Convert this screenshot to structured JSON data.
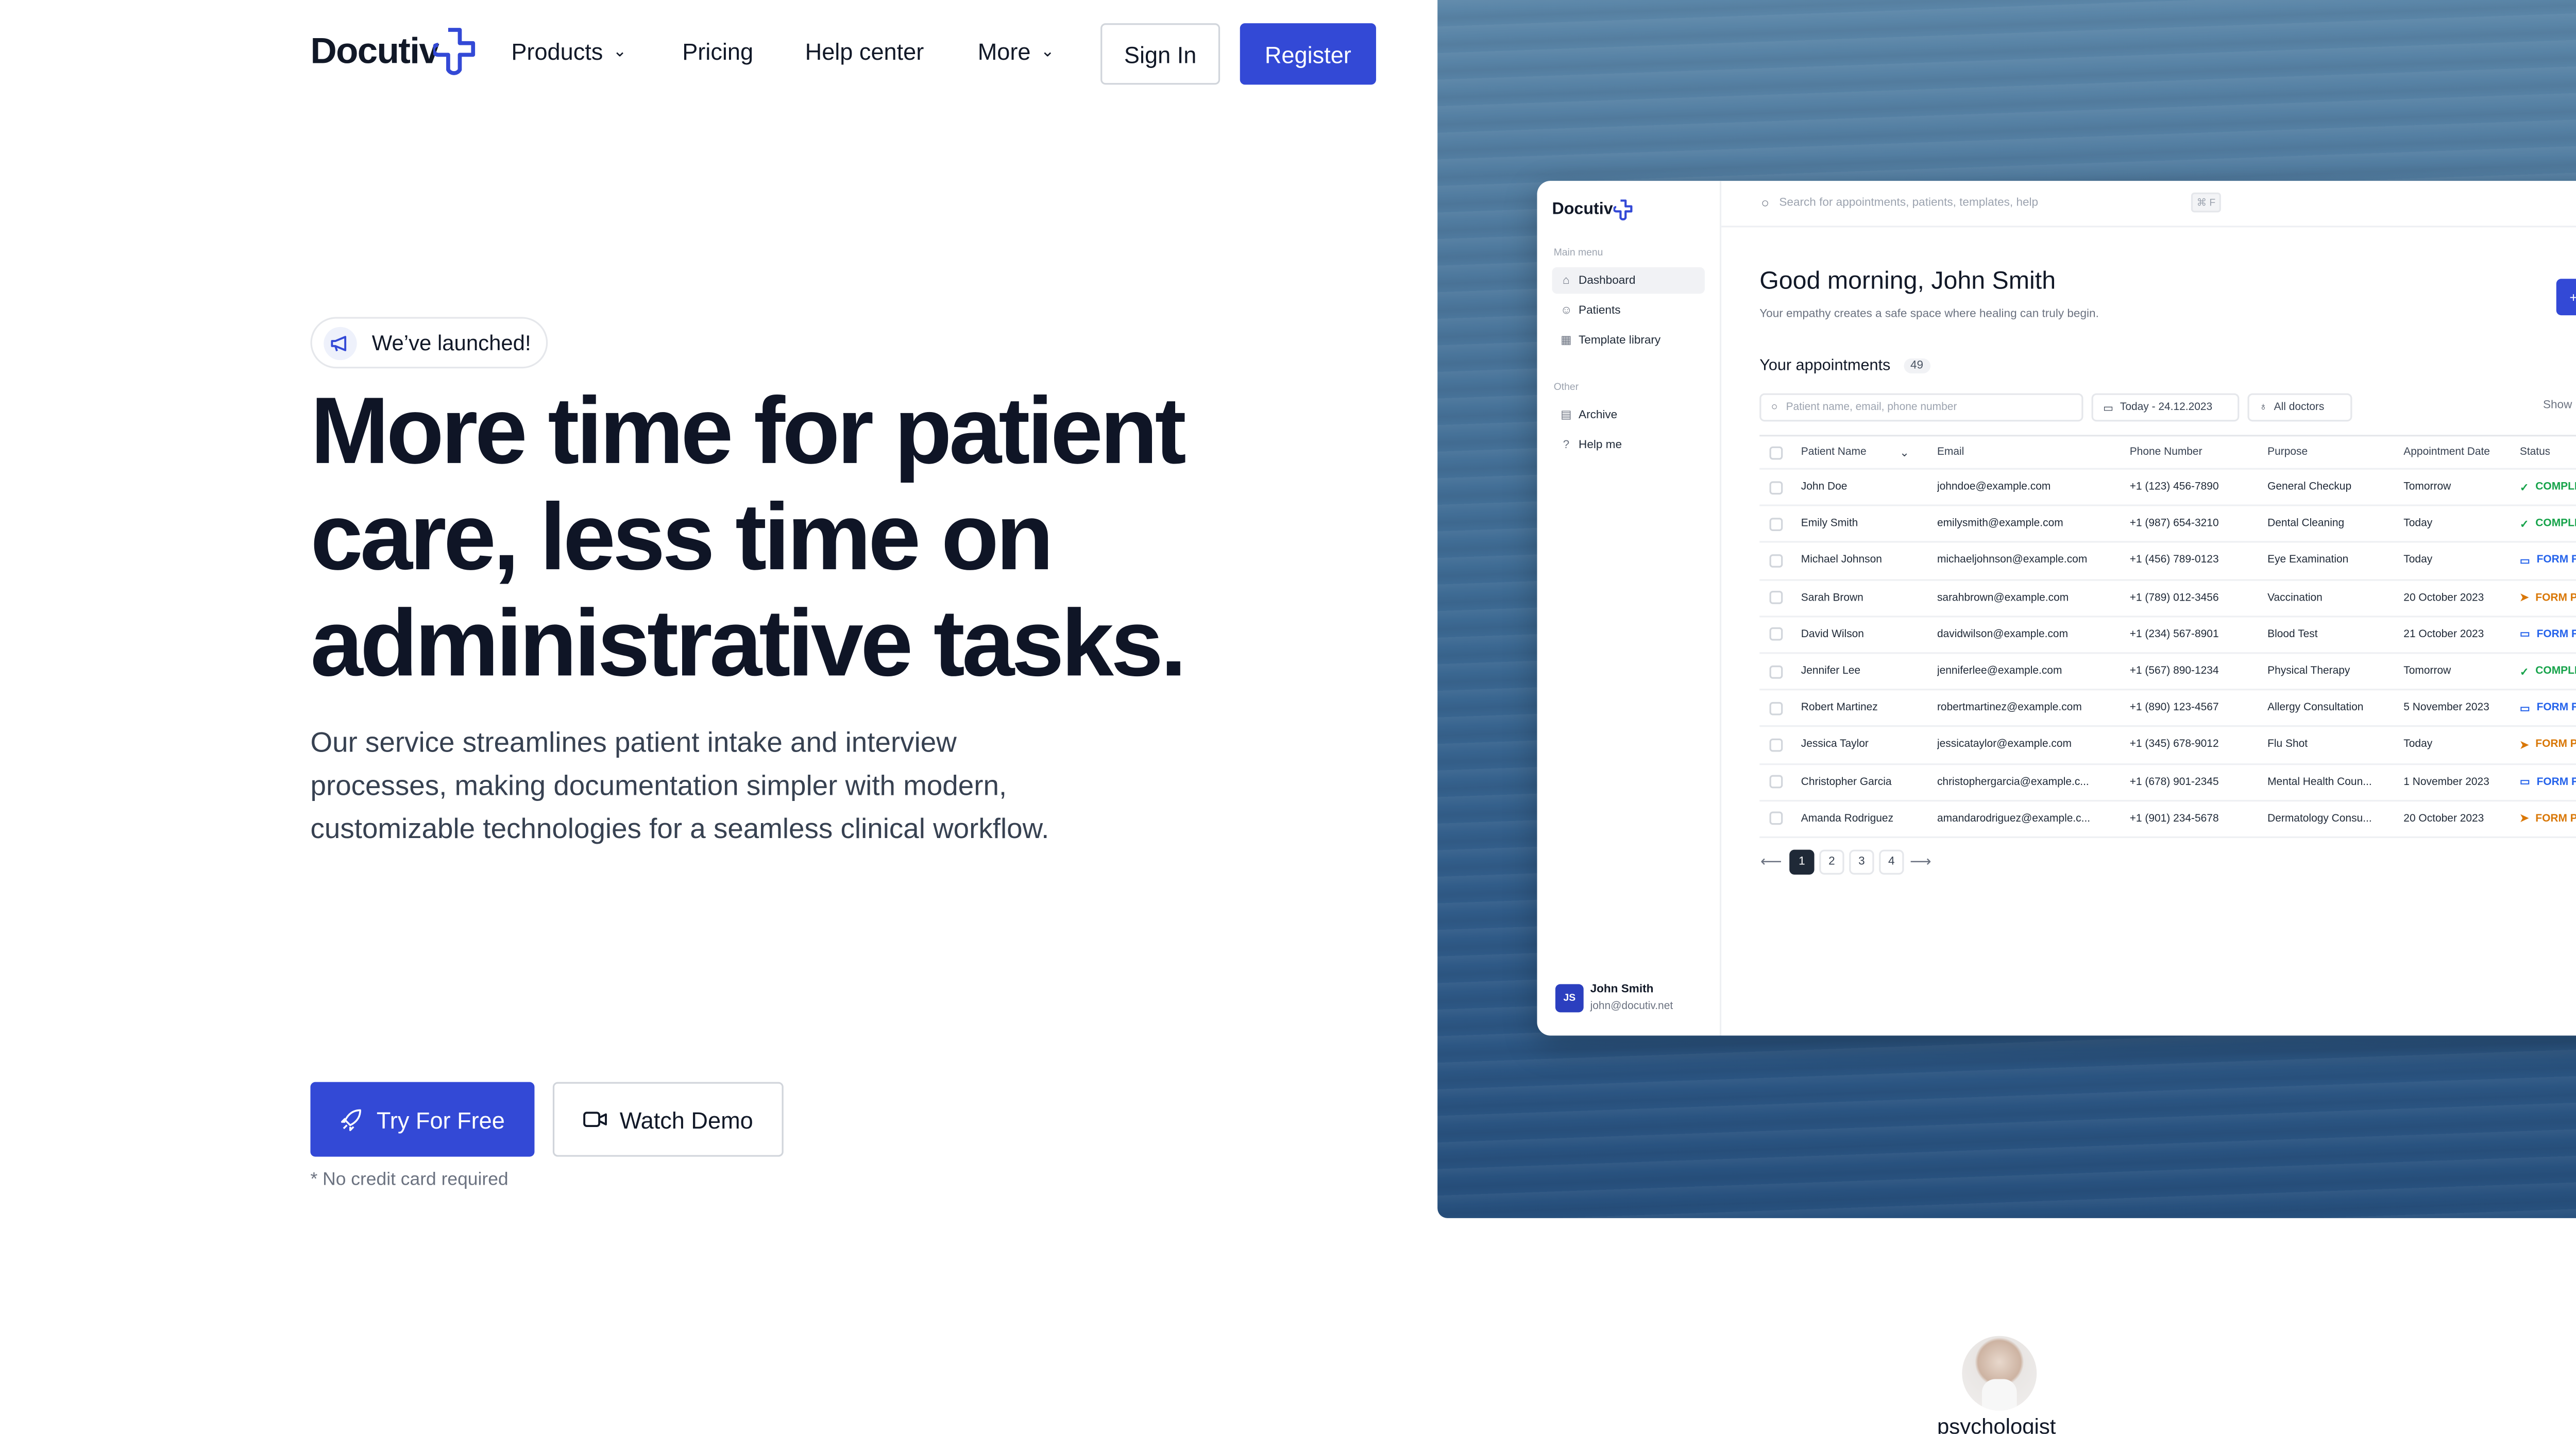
{
  "nav": {
    "logo": "Docutiv",
    "items": [
      "Products",
      "Pricing",
      "Help center",
      "More"
    ],
    "signin": "Sign In",
    "register": "Register"
  },
  "hero": {
    "badge": "We’ve launched!",
    "headline_lines": [
      "More time for patient",
      "care, less time on",
      "administrative tasks."
    ],
    "subtitle_lines": [
      "Our service streamlines patient intake and interview",
      "processes, making documentation simpler with modern,",
      "customizable technologies for a seamless clinical workflow."
    ],
    "try_label": "Try For Free",
    "demo_label": "Watch Demo",
    "no_card": "* No credit card required"
  },
  "app": {
    "logo": "Docutiv",
    "search_placeholder": "Search for appointments, patients, templates, help",
    "kbd": "⌘ F",
    "main_menu_label": "Main menu",
    "menu": [
      "Dashboard",
      "Patients",
      "Template library"
    ],
    "other_label": "Other",
    "other": [
      "Archive",
      "Help me"
    ],
    "user_initials": "JS",
    "user_name": "John Smith",
    "user_email": "john@docutiv.net",
    "greeting": "Good morning, John Smith",
    "greeting_sub": "Your empathy creates a safe space where healing can truly begin.",
    "new_label": "+ Ne",
    "appointments_title": "Your appointments",
    "appointments_count": "49",
    "filter_placeholder": "Patient name, email, phone number",
    "date_filter": "Today - 24.12.2023",
    "doctor_filter": "All doctors",
    "show_label": "Show",
    "columns": [
      "Patient Name",
      "Email",
      "Phone Number",
      "Purpose",
      "Appointment Date",
      "Status"
    ],
    "rows": [
      {
        "name": "John Doe",
        "email": "johndoe@example.com",
        "phone": "+1 (123) 456-7890",
        "purpose": "General Checkup",
        "date": "Tomorrow",
        "status": "COMPLETE"
      },
      {
        "name": "Emily Smith",
        "email": "emilysmith@example.com",
        "phone": "+1 (987) 654-3210",
        "purpose": "Dental Cleaning",
        "date": "Today",
        "status": "COMPLETE"
      },
      {
        "name": "Michael Johnson",
        "email": "michaeljohnson@example.com",
        "phone": "+1 (456) 789-0123",
        "purpose": "Eye Examination",
        "date": "Today",
        "status": "FORM FIL"
      },
      {
        "name": "Sarah Brown",
        "email": "sarahbrown@example.com",
        "phone": "+1 (789) 012-3456",
        "purpose": "Vaccination",
        "date": "20 October 2023",
        "status": "FORM PE"
      },
      {
        "name": "David Wilson",
        "email": "davidwilson@example.com",
        "phone": "+1 (234) 567-8901",
        "purpose": "Blood Test",
        "date": "21 October 2023",
        "status": "FORM FIL"
      },
      {
        "name": "Jennifer Lee",
        "email": "jenniferlee@example.com",
        "phone": "+1 (567) 890-1234",
        "purpose": "Physical Therapy",
        "date": "Tomorrow",
        "status": "COMPLETE"
      },
      {
        "name": "Robert Martinez",
        "email": "robertmartinez@example.com",
        "phone": "+1 (890) 123-4567",
        "purpose": "Allergy Consultation",
        "date": "5 November 2023",
        "status": "FORM FIL"
      },
      {
        "name": "Jessica Taylor",
        "email": "jessicataylor@example.com",
        "phone": "+1 (345) 678-9012",
        "purpose": "Flu Shot",
        "date": "Today",
        "status": "FORM PE"
      },
      {
        "name": "Christopher Garcia",
        "email": "christophergarcia@example.c...",
        "phone": "+1 (678) 901-2345",
        "purpose": "Mental Health Coun...",
        "date": "1 November 2023",
        "status": "FORM FIL"
      },
      {
        "name": "Amanda Rodriguez",
        "email": "amandarodriguez@example.c...",
        "phone": "+1 (901) 234-5678",
        "purpose": "Dermatology Consu...",
        "date": "20 October 2023",
        "status": "FORM PE"
      }
    ],
    "pages": [
      "1",
      "2",
      "3",
      "4"
    ],
    "current_page": "1"
  },
  "footer_preview": {
    "label": "psychologist"
  },
  "colors": {
    "primary": "#3349d6",
    "complete": "#16a34a",
    "form_filled": "#2563eb",
    "form_pending": "#d97706"
  }
}
